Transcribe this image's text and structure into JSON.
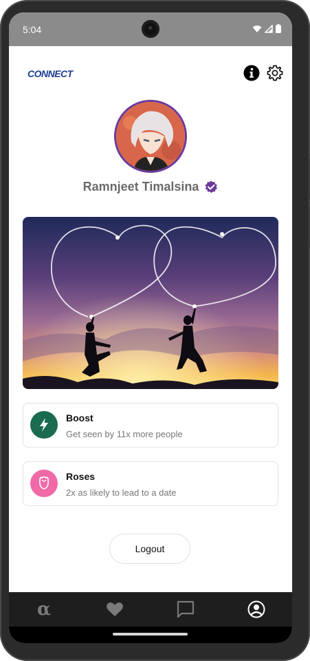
{
  "status_bar": {
    "time": "5:04"
  },
  "header": {
    "logo_text": "CONNECT"
  },
  "profile": {
    "name": "Ramnjeet Timalsina",
    "verified": true,
    "accent_color": "#6a3a9a"
  },
  "features": [
    {
      "title": "Boost",
      "subtitle": "Get seen by 11x more people",
      "icon": "lightning-icon",
      "icon_bg": "#1a6b4f"
    },
    {
      "title": "Roses",
      "subtitle": "2x as likely to lead to a date",
      "icon": "rose-icon",
      "icon_bg": "#f06aa8"
    }
  ],
  "logout_label": "Logout",
  "bottom_nav": {
    "items": [
      {
        "id": "home",
        "label": "α",
        "icon": "alpha-icon"
      },
      {
        "id": "likes",
        "icon": "heart-icon"
      },
      {
        "id": "chat",
        "icon": "chat-icon"
      },
      {
        "id": "profile",
        "icon": "profile-icon",
        "active": true
      }
    ]
  }
}
